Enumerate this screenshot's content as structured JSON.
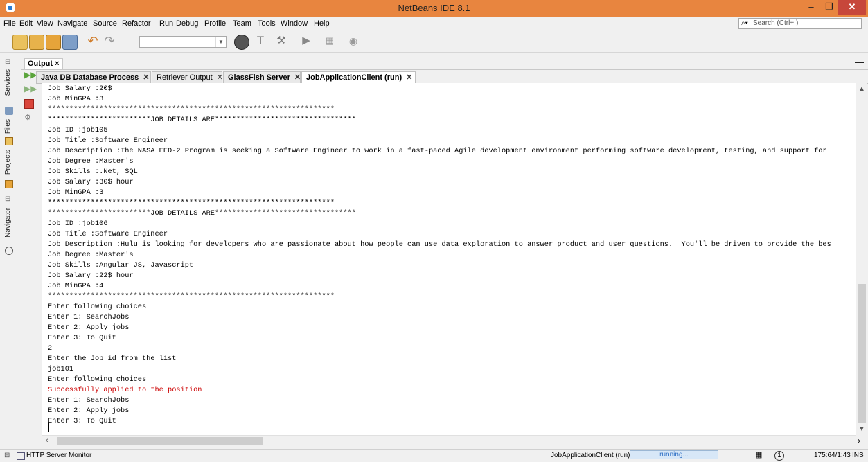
{
  "window": {
    "title": "NetBeans IDE 8.1"
  },
  "menu": [
    "File",
    "Edit",
    "View",
    "Navigate",
    "Source",
    "Refactor",
    "Run",
    "Debug",
    "Profile",
    "Team",
    "Tools",
    "Window",
    "Help"
  ],
  "search": {
    "placeholder": "Search (Ctrl+I)"
  },
  "left_tabs": [
    "Services",
    "Files",
    "Projects",
    "Navigator"
  ],
  "output": {
    "header": "Output ×",
    "tabs": [
      {
        "label": "Java DB Database Process",
        "bold": true
      },
      {
        "label": "Retriever Output",
        "bold": false
      },
      {
        "label": "GlassFish Server",
        "bold": true
      },
      {
        "label": "JobApplicationClient (run)",
        "bold": true,
        "active": true
      }
    ],
    "lines": [
      {
        "text": "Job Salary :20$",
        "err": false
      },
      {
        "text": "Job MinGPA :3",
        "err": false
      },
      {
        "text": "*******************************************************************",
        "err": false
      },
      {
        "text": "************************JOB DETAILS ARE*********************************",
        "err": false
      },
      {
        "text": "Job ID :job105",
        "err": false
      },
      {
        "text": "Job Title :Software Engineer",
        "err": false
      },
      {
        "text": "Job Description :The NASA EED-2 Program is seeking a Software Engineer to work in a fast-paced Agile development environment performing software development, testing, and support for",
        "err": false
      },
      {
        "text": "Job Degree :Master's",
        "err": false
      },
      {
        "text": "Job Skills :.Net, SQL",
        "err": false
      },
      {
        "text": "Job Salary :30$ hour",
        "err": false
      },
      {
        "text": "Job MinGPA :3",
        "err": false
      },
      {
        "text": "*******************************************************************",
        "err": false
      },
      {
        "text": "************************JOB DETAILS ARE*********************************",
        "err": false
      },
      {
        "text": "Job ID :job106",
        "err": false
      },
      {
        "text": "Job Title :Software Engineer",
        "err": false
      },
      {
        "text": "Job Description :Hulu is looking for developers who are passionate about how people can use data exploration to answer product and user questions.  You'll be driven to provide the bes",
        "err": false
      },
      {
        "text": "Job Degree :Master's",
        "err": false
      },
      {
        "text": "Job Skills :Angular JS, Javascript",
        "err": false
      },
      {
        "text": "Job Salary :22$ hour",
        "err": false
      },
      {
        "text": "Job MinGPA :4",
        "err": false
      },
      {
        "text": "*******************************************************************",
        "err": false
      },
      {
        "text": "Enter following choices",
        "err": false
      },
      {
        "text": "Enter 1: SearchJobs",
        "err": false
      },
      {
        "text": "Enter 2: Apply jobs",
        "err": false
      },
      {
        "text": "Enter 3: To Quit",
        "err": false
      },
      {
        "text": "2",
        "err": false
      },
      {
        "text": "Enter the Job id from the list",
        "err": false
      },
      {
        "text": "job101",
        "err": false
      },
      {
        "text": "Enter following choices",
        "err": false
      },
      {
        "text": "Successfully applied to the position",
        "err": true
      },
      {
        "text": "Enter 1: SearchJobs",
        "err": false
      },
      {
        "text": "Enter 2: Apply jobs",
        "err": false
      },
      {
        "text": "Enter 3: To Quit",
        "err": false
      }
    ]
  },
  "status": {
    "left": "HTTP Server Monitor",
    "process": "JobApplicationClient (run)",
    "progress_text": "running...",
    "position": "175:64/1:43",
    "mode": "INS",
    "notifications": "1"
  },
  "colors": {
    "titlebar": "#e8853f",
    "error_text": "#cc0000",
    "close_button": "#c7473b"
  }
}
